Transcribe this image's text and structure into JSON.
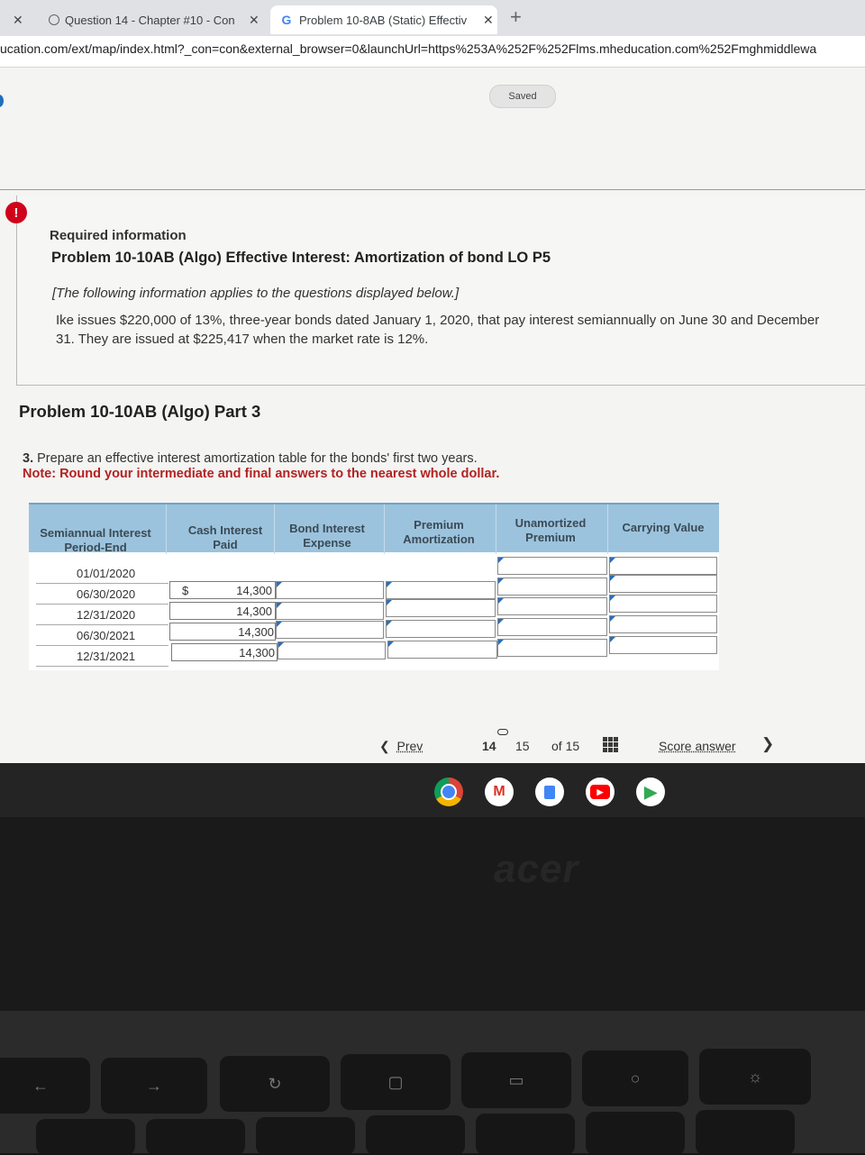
{
  "browser": {
    "tabs": [
      {
        "title": "Question 14 - Chapter #10 - Con",
        "favicon": "globe-icon"
      },
      {
        "title": "Problem 10-8AB (Static) Effectiv",
        "favicon": "google-icon"
      }
    ],
    "url": "ucation.com/ext/map/index.html?_con=con&external_browser=0&launchUrl=https%253A%252F%252Flms.mheducation.com%252Fmghmiddlewa"
  },
  "header": {
    "saved_label": "Saved"
  },
  "info": {
    "alert_symbol": "!",
    "required": "Required information",
    "problem_title": "Problem 10-10AB (Algo) Effective Interest: Amortization of bond LO P5",
    "note": "[The following information applies to the questions displayed below.]",
    "paragraph": "Ike issues $220,000 of 13%, three-year bonds dated January 1, 2020, that pay interest semiannually on June 30 and December 31. They are issued at $225,417 when the market rate is 12%."
  },
  "part": {
    "title": "Problem 10-10AB (Algo) Part 3",
    "question_num": "3.",
    "question": "Prepare an effective interest amortization table for the bonds' first two years.",
    "note": "Note: Round your intermediate and final answers to the nearest whole dollar."
  },
  "table": {
    "headers": [
      [
        "Semiannual Interest",
        "Period-End"
      ],
      [
        "Cash Interest",
        "Paid"
      ],
      [
        "Bond Interest",
        "Expense"
      ],
      [
        "Premium",
        "Amortization"
      ],
      [
        "Unamortized",
        "Premium"
      ],
      [
        "Carrying Value",
        ""
      ]
    ],
    "currency": "$",
    "rows": [
      {
        "date": "01/01/2020",
        "cash": ""
      },
      {
        "date": "06/30/2020",
        "cash": "14,300"
      },
      {
        "date": "12/31/2020",
        "cash": "14,300"
      },
      {
        "date": "06/30/2021",
        "cash": "14,300"
      },
      {
        "date": "12/31/2021",
        "cash": "14,300"
      }
    ]
  },
  "pager": {
    "prev": "Prev",
    "current": "14",
    "next": "15",
    "of": "of 15",
    "score": "Score answer"
  },
  "device": {
    "brand": "acer"
  },
  "colors": {
    "accent_blue": "#2a6ebb",
    "header_blue": "#9cc3dd",
    "note_red": "#b22222",
    "alert_red": "#d0021b"
  }
}
